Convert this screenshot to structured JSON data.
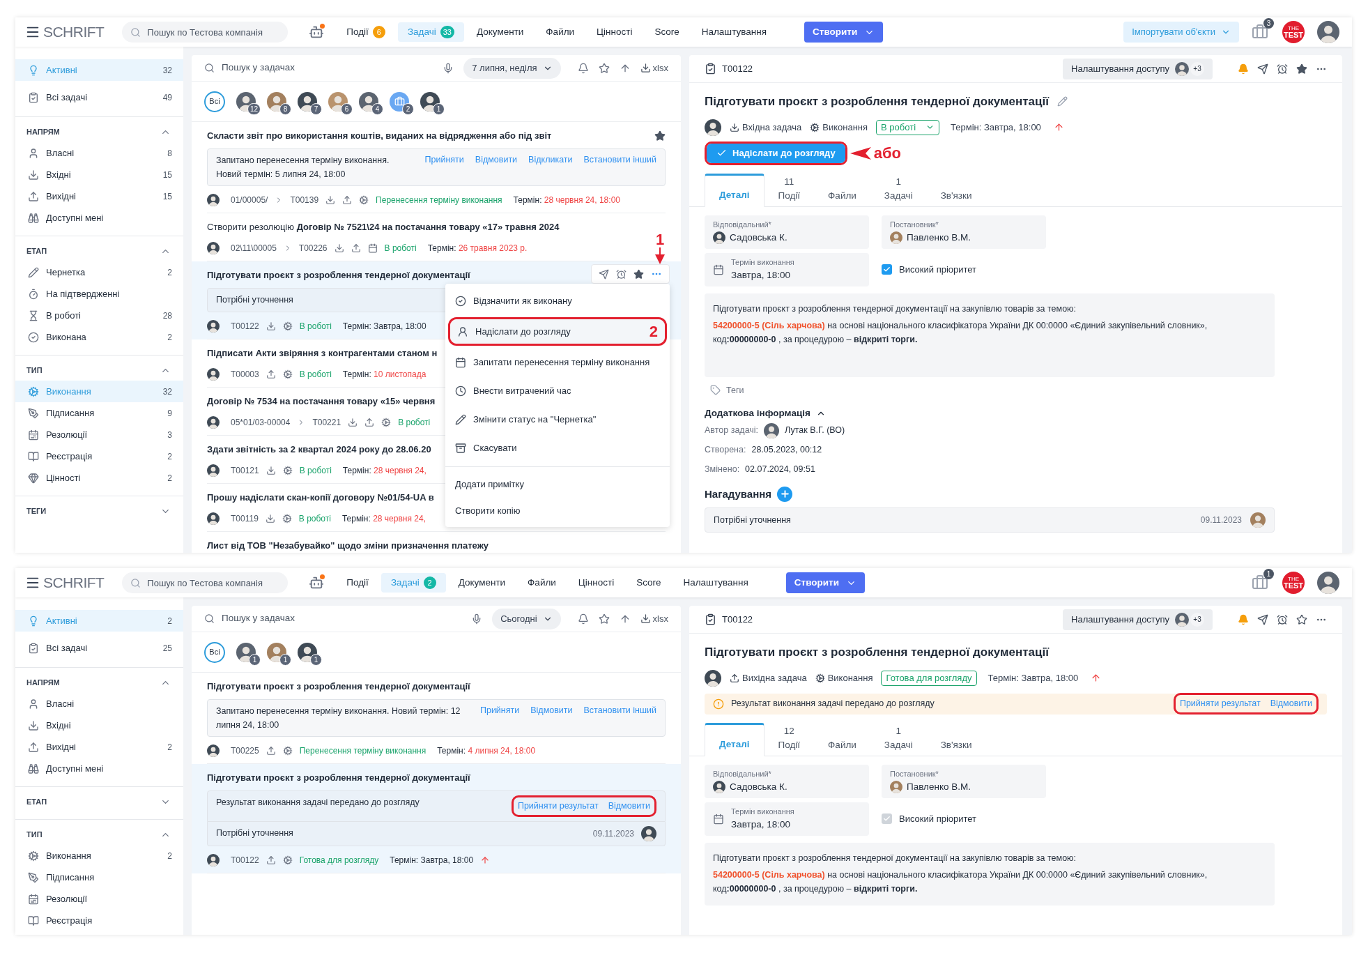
{
  "screens": [
    {
      "header": {
        "logo": "SCHRIFT",
        "search_placeholder": "Пошук по Тестова компанія",
        "nav": [
          {
            "label": "Події",
            "count": "6",
            "color": "#f59e0b",
            "selected": false
          },
          {
            "label": "Задачі",
            "count": "33",
            "color": "#14b8a6",
            "selected": true
          },
          {
            "label": "Документи",
            "selected": false
          },
          {
            "label": "Файли",
            "selected": false
          },
          {
            "label": "Цінності",
            "selected": false
          },
          {
            "label": "Score",
            "selected": false
          },
          {
            "label": "Налаштування",
            "selected": false
          }
        ],
        "create_button": "Створити",
        "import_button": "Імпортувати об'єкти",
        "inbox_count": "3",
        "company_logo": {
          "small": "THE",
          "main": "TEST"
        }
      },
      "sidebar": {
        "items": [
          {
            "label": "Активні",
            "count": "32",
            "selected": true
          },
          {
            "label": "Всі задачі",
            "count": "49",
            "selected": false
          }
        ],
        "groups": [
          {
            "title": "НАПРЯМ",
            "expanded": true,
            "items": [
              {
                "label": "Власні",
                "count": "8",
                "selected": false
              },
              {
                "label": "Вхідні",
                "count": "15",
                "selected": false
              },
              {
                "label": "Вихідні",
                "count": "15",
                "selected": false
              },
              {
                "label": "Доступні мені",
                "selected": false
              }
            ]
          },
          {
            "title": "ЕТАП",
            "expanded": true,
            "items": [
              {
                "label": "Чернетка",
                "count": "2",
                "selected": false
              },
              {
                "label": "На підтвердженні",
                "selected": false
              },
              {
                "label": "В роботі",
                "count": "28",
                "selected": false
              },
              {
                "label": "Виконана",
                "count": "2",
                "selected": false
              }
            ]
          },
          {
            "title": "ТИП",
            "expanded": true,
            "items": [
              {
                "label": "Виконання",
                "count": "32",
                "selected": true
              },
              {
                "label": "Підписання",
                "count": "9",
                "selected": false
              },
              {
                "label": "Резолюції",
                "count": "3",
                "selected": false
              },
              {
                "label": "Реєстрація",
                "count": "2",
                "selected": false
              },
              {
                "label": "Цінності",
                "count": "2",
                "selected": false
              }
            ]
          },
          {
            "title": "ТЕГИ",
            "expanded": false
          }
        ]
      },
      "list": {
        "search_placeholder": "Пошук у задачах",
        "date_filter": "7 липня, неділя",
        "export": "xlsx",
        "people_filter": {
          "all": "Всі",
          "people": [
            {
              "count": "12",
              "kind": "person"
            },
            {
              "count": "8",
              "kind": "person"
            },
            {
              "count": "7",
              "kind": "person"
            },
            {
              "count": "6",
              "kind": "person"
            },
            {
              "count": "4",
              "kind": "person"
            },
            {
              "count": "2",
              "kind": "group"
            },
            {
              "count": "1",
              "kind": "person"
            }
          ]
        },
        "tasks": [
          {
            "title": "Скласти звіт про використання коштів, виданих на відрядження або під звіт",
            "kind": "execution",
            "starred": true,
            "selected": false,
            "notice": {
              "text": "Запитано перенесення терміну виконання.",
              "subtext": "Новий термін: 5 липня 24, 18:00",
              "actions": [
                "Прийняти",
                "Відмовити",
                "Відкликати",
                "Встановити інший"
              ]
            },
            "ref": "01/00005/",
            "id": "T00139",
            "incoming": true,
            "outgoing": true,
            "status": "Перенесення терміну виконання",
            "term_label": "Термін:",
            "term": "28 червня 24, 18:00",
            "overdue": true
          },
          {
            "title": "Створити резолюцію **Договір № 7521\\24 на постачання товару «17» травня 2024**",
            "kind": "resolution",
            "selected": false,
            "ref": "02\\11\\00005",
            "id": "T00226",
            "incoming": true,
            "outgoing": true,
            "status": "В роботі",
            "term_label": "Термін:",
            "term": "26 травня 2023 р.",
            "overdue": true
          },
          {
            "title": "Підготувати проєкт з розроблення тендерної документації",
            "kind": "execution",
            "selected": true,
            "hovered": true,
            "annotation": "1",
            "note": {
              "text": "Потрібні уточнення"
            },
            "id": "T00122",
            "incoming": true,
            "status": "В роботі",
            "term_label": "Термін:",
            "term": "Завтра, 18:00",
            "overdue": false
          },
          {
            "title": "Підписати Акти звіряння з контрагентами станом н",
            "kind": "execution",
            "selected": false,
            "id": "T00003",
            "outgoing": true,
            "status": "В роботі",
            "term_label": "Термін:",
            "term": "10 листопада",
            "overdue": true
          },
          {
            "title": "Договір № 7534 на постачання товару «15» червня",
            "kind": "execution",
            "selected": false,
            "ref": "05*01/03-00004",
            "id": "T00221",
            "incoming": true,
            "outgoing": true,
            "status": "В роботі"
          },
          {
            "title": "Здати звітність за 2 квартал 2024 року до 28.06.20",
            "kind": "execution",
            "selected": false,
            "id": "T00121",
            "incoming": true,
            "status": "В роботі",
            "term_label": "Термін:",
            "term": "28 червня 24,",
            "overdue": true
          },
          {
            "title": "Прошу надіслати скан-копії договору №01/54-UA в",
            "kind": "execution",
            "selected": false,
            "id": "T00119",
            "incoming": true,
            "status": "В роботі",
            "term_label": "Термін:",
            "term": "28 червня 24,",
            "overdue": true
          },
          {
            "title": "Лист від ТОВ \"Незабувайко\" щодо зміни призначення платежу",
            "kind": "execution",
            "selected": false
          }
        ],
        "menu": {
          "items": [
            {
              "label": "Відзначити як виконану",
              "selected": false
            },
            {
              "label": "Надіслати до розгляду",
              "selected": true,
              "annotation": "2"
            },
            {
              "label": "Запитати перенесення терміну виконання",
              "selected": false
            },
            {
              "label": "Внести витрачений час",
              "selected": false
            },
            {
              "label": "Змінити статус на \"Чернетка\"",
              "selected": false
            },
            {
              "label": "Скасувати",
              "selected": false
            }
          ],
          "extra_items": [
            {
              "label": "Додати примітку",
              "selected": false
            },
            {
              "label": "Створити копію",
              "selected": false
            }
          ]
        }
      },
      "detail": {
        "id": "T00122",
        "access_button": "Налаштування доступу",
        "access_more": "+3",
        "starred": true,
        "title": "Підготувати проєкт з розроблення тендерної документації",
        "editable": true,
        "direction": {
          "label": "Вхідна задача",
          "kind": "in"
        },
        "type": "Виконання",
        "status": {
          "label": "В роботі",
          "dropdown": true
        },
        "term_label": "Термін:",
        "term": "Завтра, 18:00",
        "high_priority": true,
        "submit_button": {
          "label": "Надіслати до розгляду",
          "circled": true,
          "annotation": "або"
        },
        "tabs": [
          {
            "label": "Деталі",
            "selected": true
          },
          {
            "count": "11",
            "label": "Події",
            "selected": false
          },
          {
            "label": "Файли",
            "selected": false
          },
          {
            "count": "1",
            "label": "Задачі",
            "selected": false
          },
          {
            "label": "Зв'язки",
            "selected": false
          }
        ],
        "responsible": {
          "label": "Відповідальний*",
          "value": "Садовська К."
        },
        "author": {
          "label": "Постановник*",
          "value": "Павленко В.М."
        },
        "deadline": {
          "label": "Термін виконання",
          "value": "Завтра, 18:00"
        },
        "priority": {
          "label": "Високий пріоритет",
          "checked": true,
          "disabled": false
        },
        "description": {
          "intro": "Підготувати проєкт з розроблення тендерної документації на закупівлю товарів за темою:",
          "code": "54200000-5 (Сіль харчова)",
          "body": " на основі національного класифікатора України ДК 00:0000 «Єдиний закупівельний словник», код**:00000000-0** , за процедурою – **відкриті торги.**"
        },
        "tags": "Теги",
        "extra_info": {
          "title": "Додаткова інформація",
          "expanded": true,
          "rows": [
            {
              "label": "Автор задачі:",
              "value": "Лутак В.Г. (ВО)",
              "kind": "person"
            },
            {
              "label": "Створена:",
              "value": "28.05.2023, 00:12",
              "kind": "text"
            },
            {
              "label": "Змінено:",
              "value": "02.07.2024, 09:51",
              "kind": "text"
            }
          ]
        },
        "reminders": {
          "title": "Нагадування",
          "items": [
            {
              "text": "Потрібні уточнення",
              "date": "09.11.2023"
            }
          ]
        }
      }
    },
    {
      "header": {
        "logo": "SCHRIFT",
        "search_placeholder": "Пошук по Тестова компанія",
        "nav": [
          {
            "label": "Події",
            "selected": false
          },
          {
            "label": "Задачі",
            "count": "2",
            "color": "#14b8a6",
            "selected": true
          },
          {
            "label": "Документи",
            "selected": false
          },
          {
            "label": "Файли",
            "selected": false
          },
          {
            "label": "Цінності",
            "selected": false
          },
          {
            "label": "Score",
            "selected": false
          },
          {
            "label": "Налаштування",
            "selected": false
          }
        ],
        "create_button": "Створити",
        "inbox_count": "1",
        "company_logo": {
          "small": "THE",
          "main": "TEST"
        }
      },
      "sidebar": {
        "items": [
          {
            "label": "Активні",
            "count": "2",
            "selected": true
          },
          {
            "label": "Всі задачі",
            "count": "25",
            "selected": false
          }
        ],
        "groups": [
          {
            "title": "НАПРЯМ",
            "expanded": true,
            "items": [
              {
                "label": "Власні",
                "selected": false
              },
              {
                "label": "Вхідні",
                "selected": false
              },
              {
                "label": "Вихідні",
                "count": "2",
                "selected": false
              },
              {
                "label": "Доступні мені",
                "selected": false
              }
            ]
          },
          {
            "title": "ЕТАП",
            "expanded": false
          },
          {
            "title": "ТИП",
            "expanded": true,
            "items": [
              {
                "label": "Виконання",
                "count": "2",
                "selected": false
              },
              {
                "label": "Підписання",
                "selected": false
              },
              {
                "label": "Резолюції",
                "selected": false
              },
              {
                "label": "Реєстрація",
                "selected": false
              }
            ]
          }
        ]
      },
      "list": {
        "search_placeholder": "Пошук у задачах",
        "date_filter": "Сьогодні",
        "export": "xlsx",
        "people_filter": {
          "all": "Всі",
          "people": [
            {
              "count": "1",
              "kind": "person"
            },
            {
              "count": "1",
              "kind": "person"
            },
            {
              "count": "1",
              "kind": "person"
            }
          ]
        },
        "tasks": [
          {
            "title": "Підготувати проєкт з розроблення тендерної документації",
            "kind": "execution",
            "selected": false,
            "notice": {
              "text": "Запитано перенесення терміну виконання. Новий термін: 12 липня 24, 18:00",
              "actions": [
                "Прийняти",
                "Відмовити",
                "Встановити інший"
              ]
            },
            "id": "T00225",
            "outgoing": true,
            "status": "Перенесення терміну виконання",
            "term_label": "Термін:",
            "term": "4 липня 24, 18:00",
            "overdue": true
          },
          {
            "title": "Підготувати проєкт з розроблення тендерної документації",
            "kind": "execution",
            "selected": true,
            "notice": {
              "text": "Результат виконання задачі передано до розгляду",
              "actions": [
                "Прийняти результат",
                "Відмовити"
              ],
              "circled": true
            },
            "note": {
              "text": "Потрібні уточнення",
              "date": "09.11.2023"
            },
            "id": "T00122",
            "outgoing": true,
            "status": "Готова для розгляду",
            "term_label": "Термін:",
            "term": "Завтра, 18:00",
            "overdue": false,
            "high_priority": true
          }
        ]
      },
      "detail": {
        "id": "T00122",
        "access_button": "Налаштування доступу",
        "access_more": "+3",
        "starred": false,
        "title": "Підготувати проєкт з розроблення тендерної документації",
        "editable": false,
        "direction": {
          "label": "Вихідна задача",
          "kind": "out"
        },
        "type": "Виконання",
        "status": {
          "label": "Готова для розгляду",
          "dropdown": false
        },
        "term_label": "Термін:",
        "term": "Завтра, 18:00",
        "high_priority": true,
        "alert": {
          "text": "Результат виконання задачі передано до розгляду",
          "actions": [
            "Прийняти результат",
            "Відмовити"
          ],
          "circled": true
        },
        "tabs": [
          {
            "label": "Деталі",
            "selected": true
          },
          {
            "count": "12",
            "label": "Події",
            "selected": false
          },
          {
            "label": "Файли",
            "selected": false
          },
          {
            "count": "1",
            "label": "Задачі",
            "selected": false
          },
          {
            "label": "Зв'язки",
            "selected": false
          }
        ],
        "responsible": {
          "label": "Відповідальний*",
          "value": "Садовська К."
        },
        "author": {
          "label": "Постановник*",
          "value": "Павленко В.М."
        },
        "deadline": {
          "label": "Термін виконання",
          "value": "Завтра, 18:00"
        },
        "priority": {
          "label": "Високий пріоритет",
          "checked": true,
          "disabled": true
        },
        "description": {
          "intro": "Підготувати проєкт з розроблення тендерної документації на закупівлю товарів за темою:",
          "code": "54200000-5 (Сіль харчова)",
          "body": " на основі національного класифікатора України ДК 00:0000 «Єдиний закупівельний словник», код**:00000000-0** , за процедурою – **відкриті торги.**"
        }
      }
    }
  ]
}
